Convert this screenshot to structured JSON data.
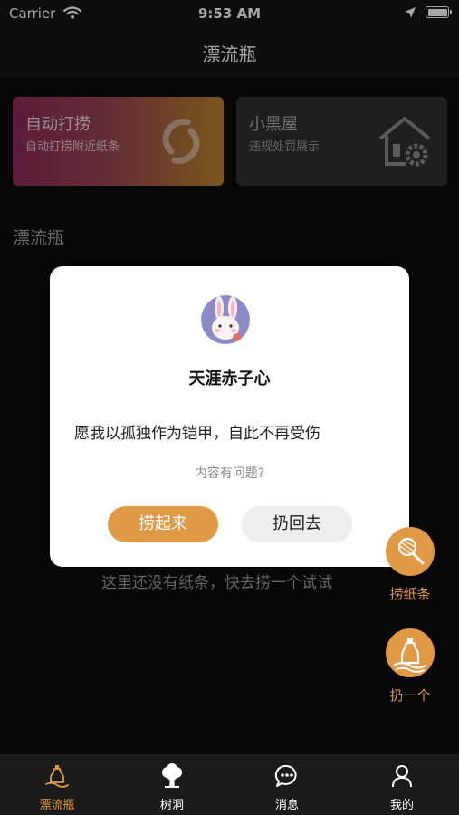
{
  "status_bar": {
    "carrier": "Carrier",
    "time": "9:53 AM"
  },
  "nav": {
    "title": "漂流瓶"
  },
  "cards": [
    {
      "title": "自动打捞",
      "subtitle": "自动打捞附近纸条",
      "icon": "refresh-link-icon"
    },
    {
      "title": "小黑屋",
      "subtitle": "违规处罚展示",
      "icon": "house-gear-icon"
    }
  ],
  "section": {
    "title": "漂流瓶"
  },
  "empty_text": "这里还没有纸条，快去捞一个试试",
  "dialog": {
    "avatar_icon": "bunny-avatar",
    "name": "天涯赤子心",
    "message": "愿我以孤独作为铠甲，自此不再受伤",
    "report_link": "内容有问题?",
    "primary_button": "捞起来",
    "secondary_button": "扔回去"
  },
  "fabs": [
    {
      "label": "捞纸条",
      "icon": "net-icon"
    },
    {
      "label": "扔一个",
      "icon": "bottle-icon"
    }
  ],
  "tabs": [
    {
      "label": "漂流瓶",
      "icon": "bottle-icon",
      "active": true
    },
    {
      "label": "树洞",
      "icon": "tree-icon",
      "active": false
    },
    {
      "label": "消息",
      "icon": "chat-bubble-icon",
      "active": false
    },
    {
      "label": "我的",
      "icon": "person-icon",
      "active": false
    }
  ],
  "colors": {
    "accent": "#e09a45",
    "background": "#0b0b0b",
    "bar": "#151515",
    "tabbar": "#1b1b1b"
  }
}
